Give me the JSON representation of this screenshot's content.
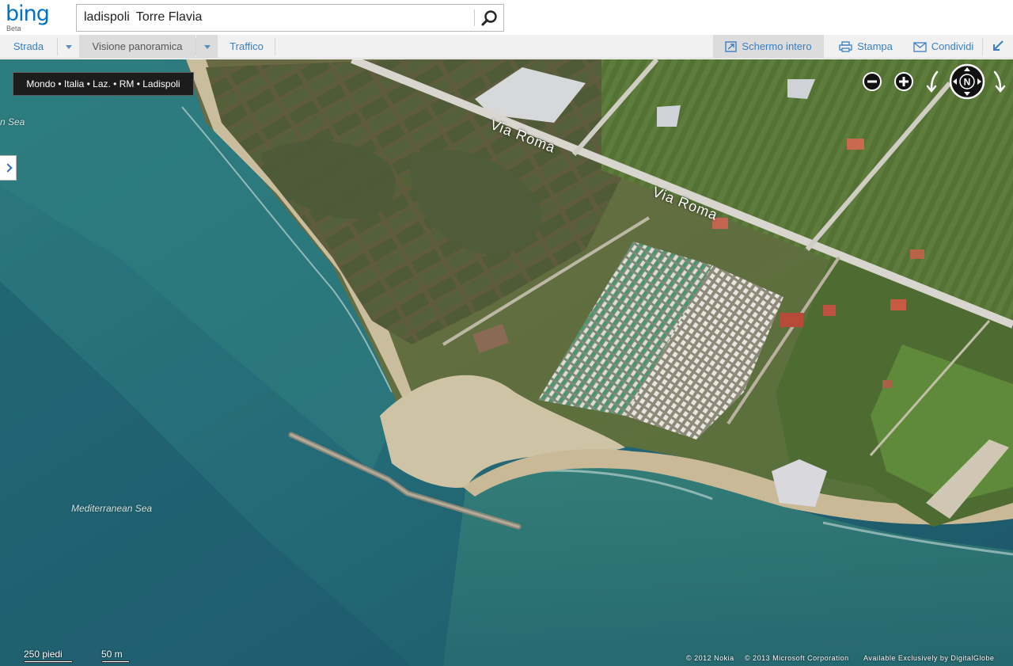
{
  "header": {
    "logo": "bing",
    "logo_sub": "Beta",
    "search_value_1": "ladispoli",
    "search_value_2": "Torre Flavia",
    "search_icon": "search-icon"
  },
  "toolbar": {
    "road": "Strada",
    "panoramic": "Visione panoramica",
    "traffic": "Traffico",
    "fullscreen": "Schermo intero",
    "print": "Stampa",
    "share": "Condividi",
    "fullscreen_icon": "fullscreen-icon",
    "print_icon": "printer-icon",
    "share_icon": "envelope-icon",
    "collapse_icon": "collapse-arrow-icon"
  },
  "map": {
    "breadcrumb": "Mondo • Italia • Laz. • RM • Ladispoli",
    "sea_label_top": "n Sea",
    "sea_label": "Mediterranean Sea",
    "road_label_1": "Via Roma",
    "road_label_2": "Via Roma",
    "compass": "N",
    "scale_feet": "250 piedi",
    "scale_meters": "50 m",
    "copyright_nokia": "© 2012 Nokia",
    "copyright_ms": "© 2013 Microsoft Corporation",
    "copyright_dg": "Available Exclusively by DigitalGlobe",
    "colors": {
      "sea_deep": "#1d5a6c",
      "sea_shallow": "#2f7f80",
      "sand": "#cfc3a6",
      "marsh": "#5b5a3a",
      "field": "#5f7a3a",
      "road": "#d8d6cf"
    }
  }
}
